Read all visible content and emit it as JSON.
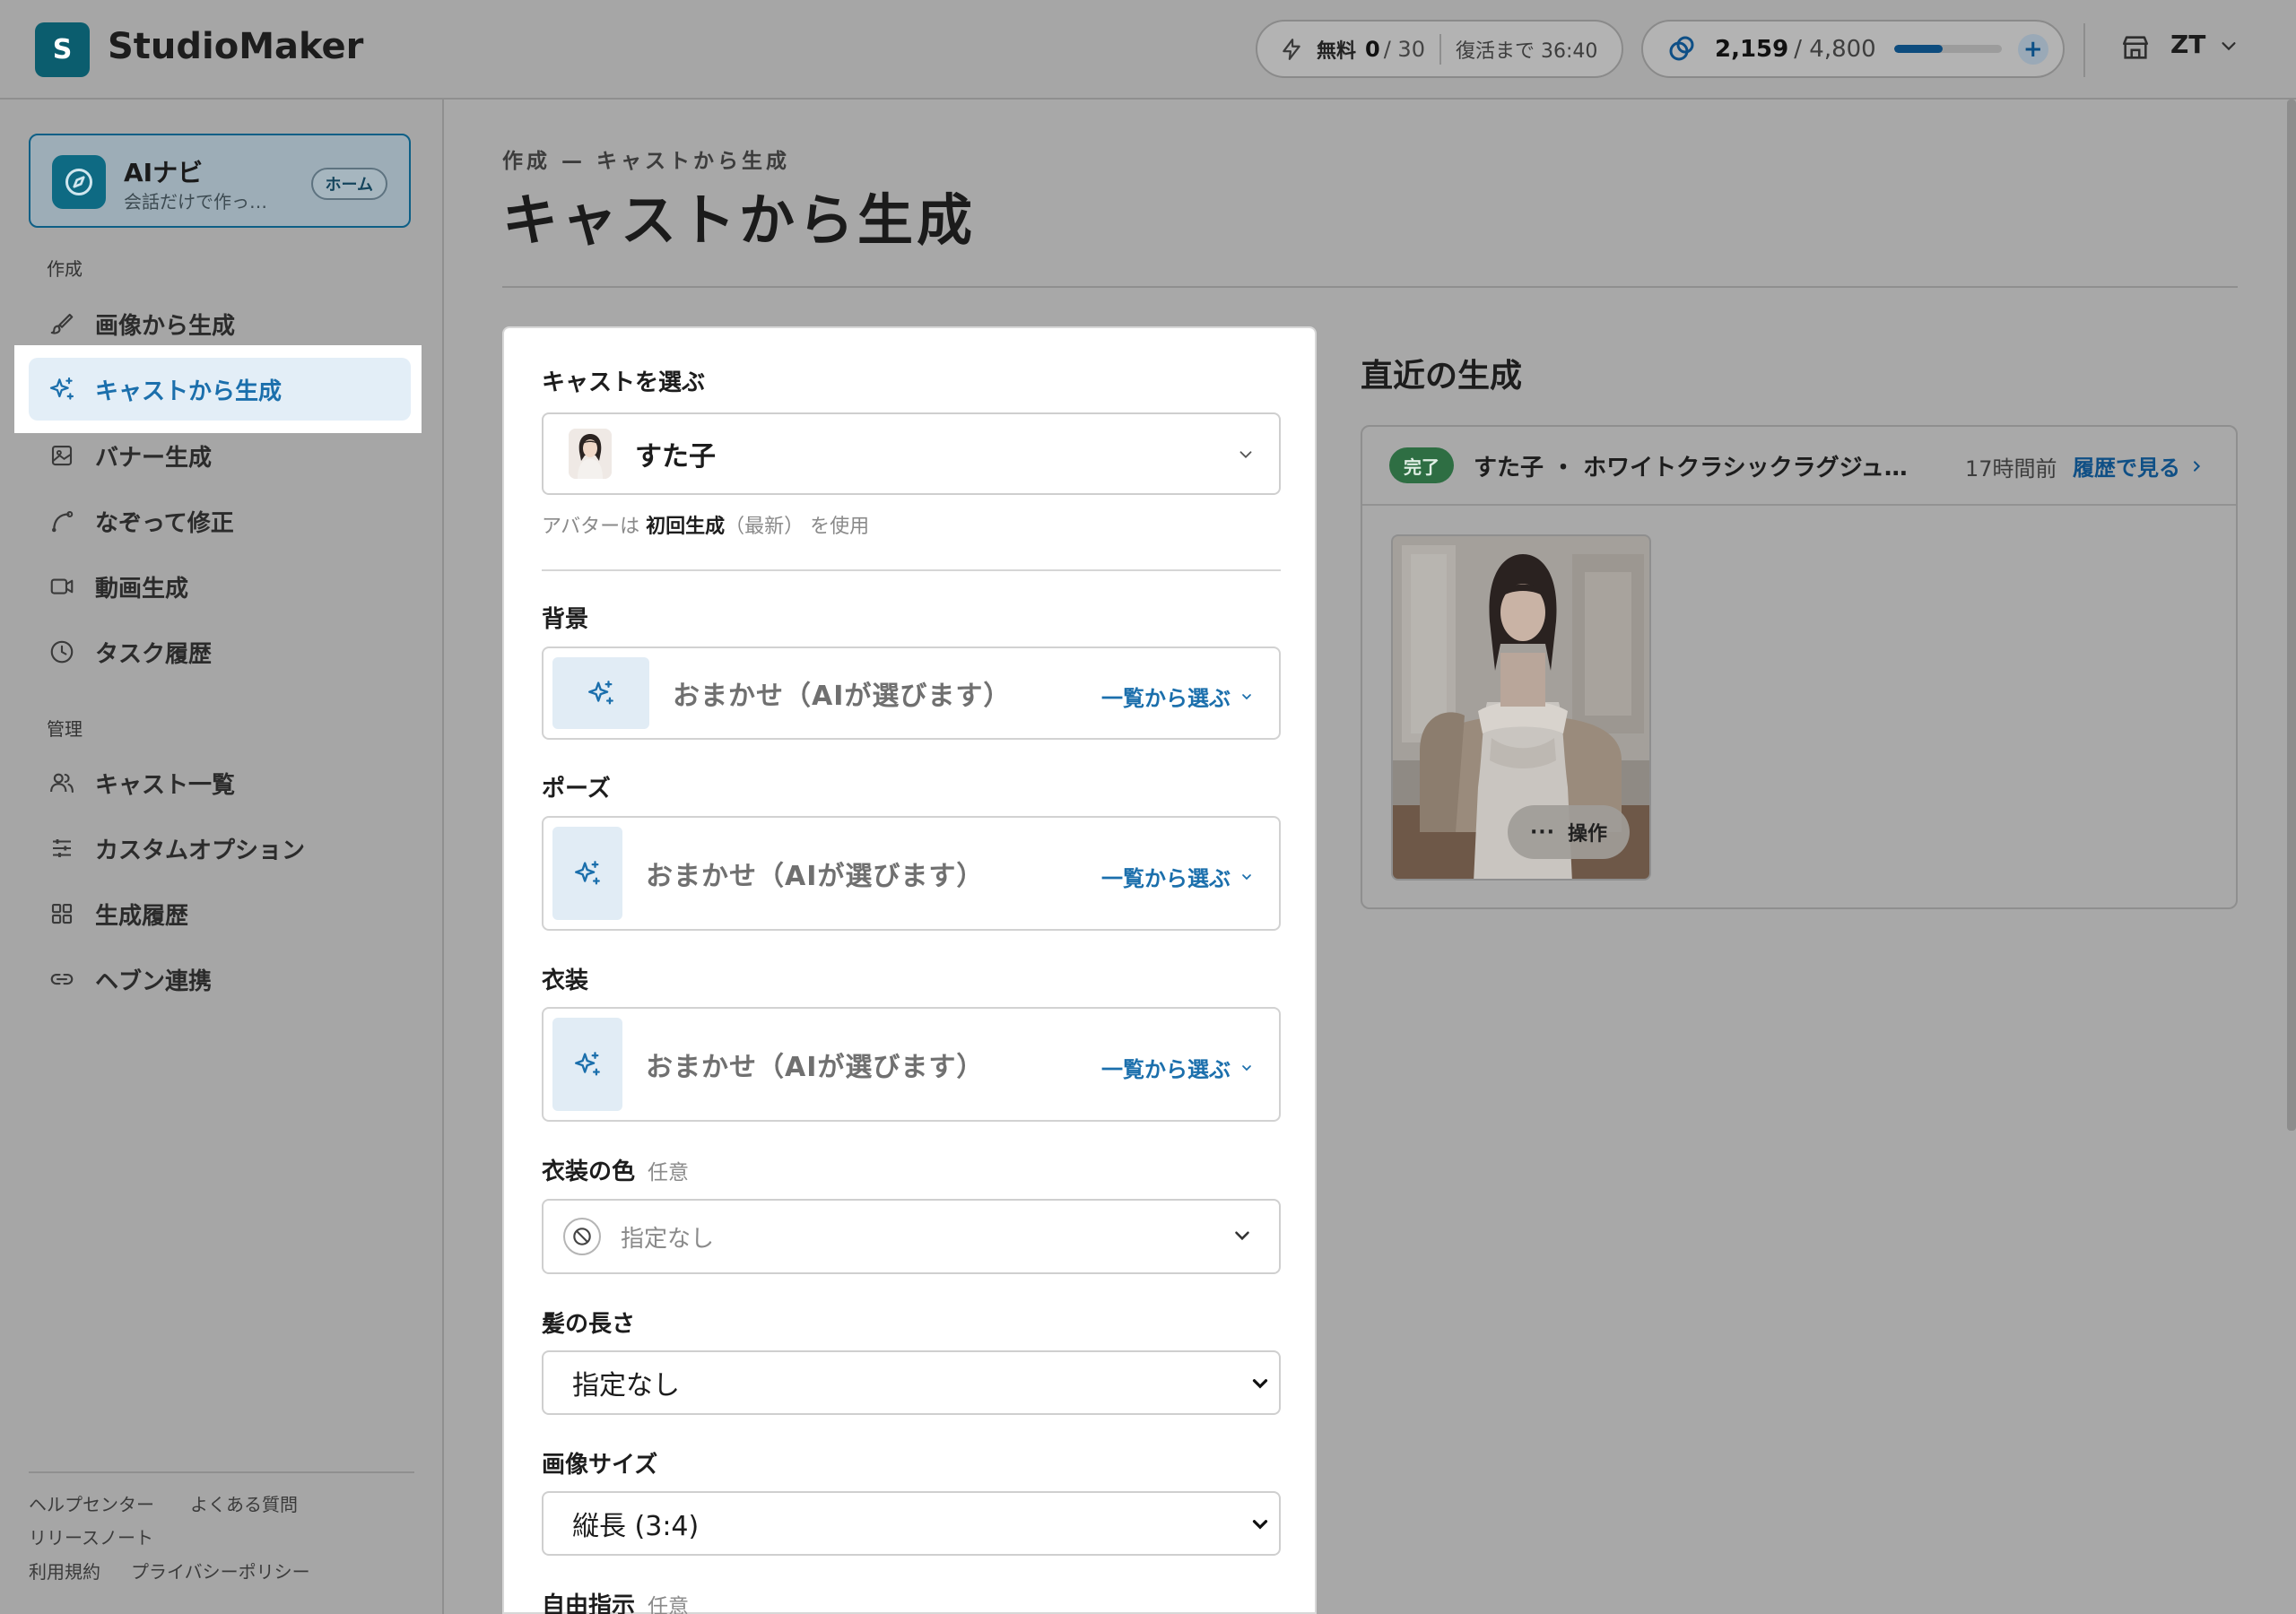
{
  "header": {
    "logo_letter": "S",
    "app_name": "StudioMaker",
    "free_label": "無料",
    "free_used": "0",
    "free_total": "/ 30",
    "revive_text": "復活まで 36:40",
    "credits_value": "2,159",
    "credits_total": "/ 4,800",
    "credits_fraction": 0.45,
    "add_button": "+",
    "user_initials": "ZT"
  },
  "sidebar": {
    "ainavi": {
      "title": "AIナビ",
      "subtitle": "会話だけで作っ…",
      "home_badge": "ホーム"
    },
    "section_create": "作成",
    "section_manage": "管理",
    "items": [
      {
        "label": "画像から生成",
        "icon": "brush-icon"
      },
      {
        "label": "キャストから生成",
        "icon": "sparkles-icon",
        "active": true
      },
      {
        "label": "バナー生成",
        "icon": "image-icon"
      },
      {
        "label": "なぞって修正",
        "icon": "pen-curve-icon"
      },
      {
        "label": "動画生成",
        "icon": "video-icon"
      },
      {
        "label": "タスク履歴",
        "icon": "clock-icon"
      },
      {
        "label": "キャスト一覧",
        "icon": "users-icon"
      },
      {
        "label": "カスタムオプション",
        "icon": "sliders-icon"
      },
      {
        "label": "生成履歴",
        "icon": "grid-icon"
      },
      {
        "label": "ヘブン連携",
        "icon": "link-icon"
      }
    ],
    "footer": {
      "help": "ヘルプセンター",
      "faq": "よくある質問",
      "release": "リリースノート",
      "terms": "利用規約",
      "privacy": "プライバシーポリシー"
    }
  },
  "main": {
    "breadcrumb": "作成 — キャストから生成",
    "title": "キャストから生成",
    "form": {
      "cast_label": "キャストを選ぶ",
      "cast_value": "すた子",
      "avatar_note_prefix": "アバターは",
      "avatar_note_bold": "初回生成",
      "avatar_note_suffix": "（最新） を使用",
      "background_label": "背景",
      "pose_label": "ポーズ",
      "costume_label": "衣装",
      "auto_text": "おまかせ（AIが選びます）",
      "pick_from_list": "一覧から選ぶ",
      "costume_color_label": "衣装の色",
      "optional": "任意",
      "costume_color_value": "指定なし",
      "hair_length_label": "髪の長さ",
      "hair_length_value": "指定なし",
      "image_size_label": "画像サイズ",
      "image_size_value": "縦長 (3:4)",
      "free_instruction_label": "自由指示"
    },
    "recent": {
      "title": "直近の生成",
      "status": "完了",
      "item_name": "すた子 ・ ホワイトクラシックラグジュ…",
      "time_ago": "17時間前",
      "history_link": "履歴で見る",
      "ops_label": "操作",
      "ops_dots": "···"
    }
  },
  "colors": {
    "accent": "#1b6fac",
    "done_green": "#2e6e43",
    "logo": "#0b5d6e"
  }
}
